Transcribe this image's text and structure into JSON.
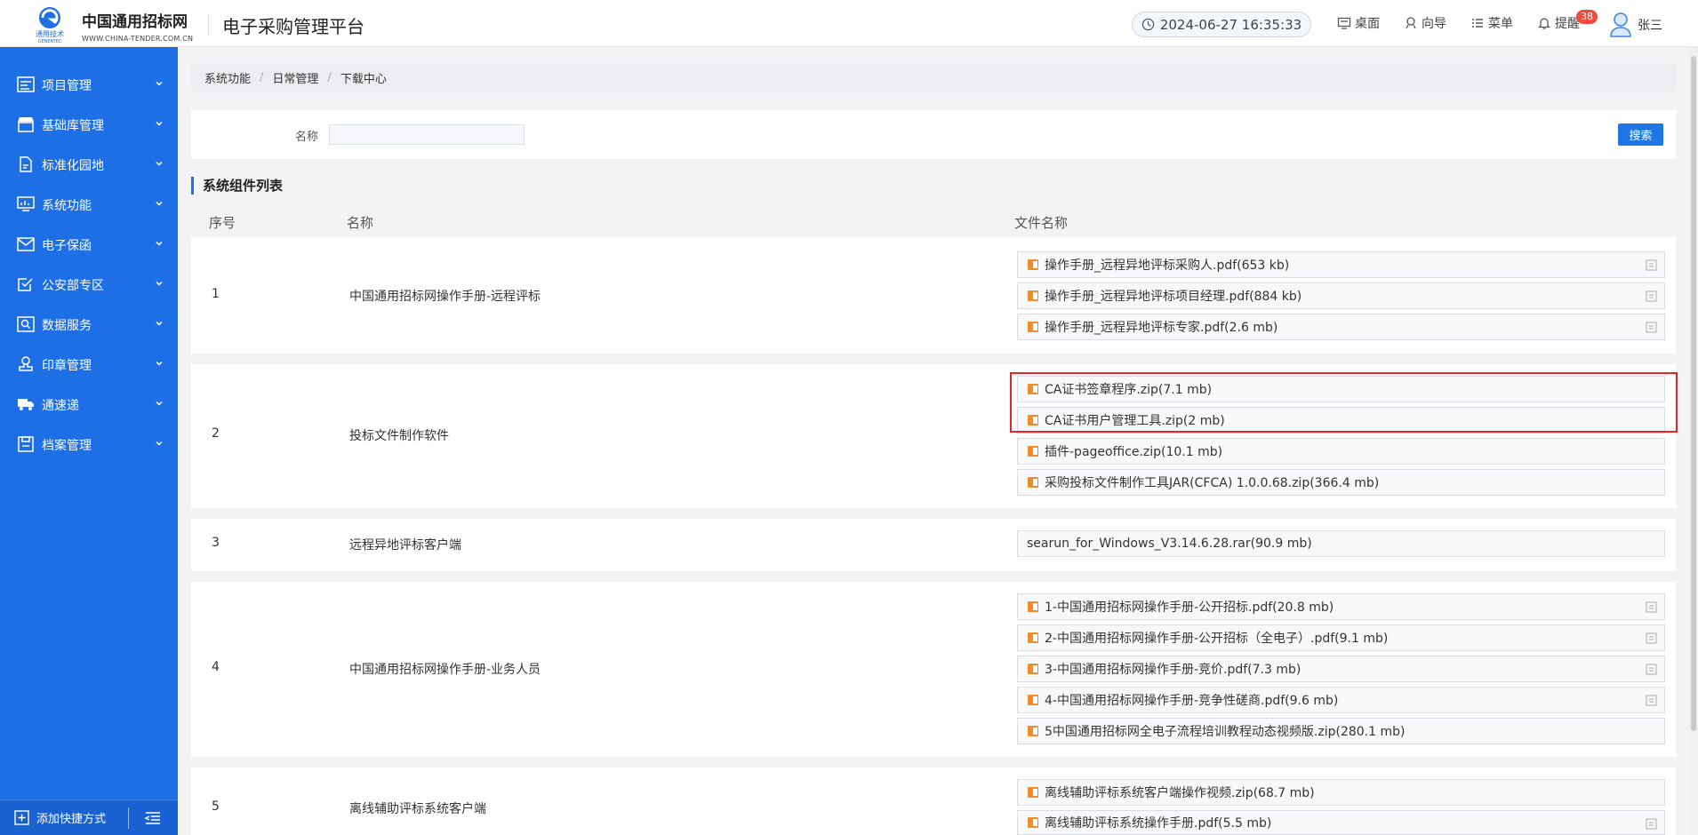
{
  "header": {
    "brand_cn": "中国通用招标网",
    "brand_en": "WWW.CHINA-TENDER.COM.CN",
    "logo_text": "通用技术",
    "platform_title": "电子采购管理平台",
    "datetime": "2024-06-27 16:35:33",
    "nav": [
      {
        "label": "桌面",
        "icon": "monitor-icon"
      },
      {
        "label": "向导",
        "icon": "guide-icon"
      },
      {
        "label": "菜单",
        "icon": "menu-icon"
      },
      {
        "label": "提醒",
        "icon": "bell-icon"
      }
    ],
    "reminder_count": "38",
    "user_name": "张三"
  },
  "sidebar": {
    "items": [
      {
        "label": "项目管理",
        "icon": "project-icon"
      },
      {
        "label": "基础库管理",
        "icon": "store-icon"
      },
      {
        "label": "标准化园地",
        "icon": "document-icon"
      },
      {
        "label": "系统功能",
        "icon": "chart-icon"
      },
      {
        "label": "电子保函",
        "icon": "mail-icon"
      },
      {
        "label": "公安部专区",
        "icon": "checkbox-icon"
      },
      {
        "label": "数据服务",
        "icon": "search-data-icon"
      },
      {
        "label": "印章管理",
        "icon": "stamp-icon"
      },
      {
        "label": "通速递",
        "icon": "truck-icon"
      },
      {
        "label": "档案管理",
        "icon": "save-icon"
      }
    ],
    "add_shortcut": "添加快捷方式"
  },
  "breadcrumb": [
    "系统功能",
    "日常管理",
    "下载中心"
  ],
  "search": {
    "label": "名称",
    "value": "",
    "placeholder": "",
    "button": "搜索"
  },
  "section_title": "系统组件列表",
  "table": {
    "headers": [
      "序号",
      "名称",
      "文件名称"
    ],
    "rows": [
      {
        "num": "1",
        "name": "中国通用招标网操作手册-远程评标",
        "files": [
          {
            "name": "操作手册_远程异地评标采购人.pdf(653 kb)",
            "icon": true
          },
          {
            "name": "操作手册_远程异地评标项目经理.pdf(884 kb)",
            "icon": true
          },
          {
            "name": "操作手册_远程异地评标专家.pdf(2.6 mb)",
            "icon": true
          }
        ]
      },
      {
        "num": "2",
        "name": "投标文件制作软件",
        "files": [
          {
            "name": "CA证书签章程序.zip(7.1 mb)",
            "icon": true
          },
          {
            "name": "CA证书用户管理工具.zip(2 mb)",
            "icon": true
          },
          {
            "name": "插件-pageoffice.zip(10.1 mb)",
            "icon": true
          },
          {
            "name": "采购投标文件制作工具JAR(CFCA) 1.0.0.68.zip(366.4 mb)",
            "icon": true
          }
        ]
      },
      {
        "num": "3",
        "name": "远程异地评标客户端",
        "files": [
          {
            "name": "searun_for_Windows_V3.14.6.28.rar(90.9 mb)",
            "icon": false
          }
        ]
      },
      {
        "num": "4",
        "name": "中国通用招标网操作手册-业务人员",
        "files": [
          {
            "name": "1-中国通用招标网操作手册-公开招标.pdf(20.8 mb)",
            "icon": true
          },
          {
            "name": "2-中国通用招标网操作手册-公开招标（全电子）.pdf(9.1 mb)",
            "icon": true
          },
          {
            "name": "3-中国通用招标网操作手册-竞价.pdf(7.3 mb)",
            "icon": true
          },
          {
            "name": "4-中国通用招标网操作手册-竞争性磋商.pdf(9.6 mb)",
            "icon": true
          },
          {
            "name": "5中国通用招标网全电子流程培训教程动态视频版.zip(280.1 mb)",
            "icon": true
          }
        ]
      },
      {
        "num": "5",
        "name": "离线辅助评标系统客户端",
        "files": [
          {
            "name": "离线辅助评标系统客户端操作视频.zip(68.7 mb)",
            "icon": true
          },
          {
            "name": "离线辅助评标系统操作手册.pdf(5.5 mb)",
            "icon": true
          }
        ]
      }
    ]
  },
  "colors": {
    "sidebar": "#1e6ee6",
    "accent": "#1d78e6",
    "highlight": "#e8232a",
    "badge": "#f24c3d",
    "file_icon": "#f08c2a"
  }
}
